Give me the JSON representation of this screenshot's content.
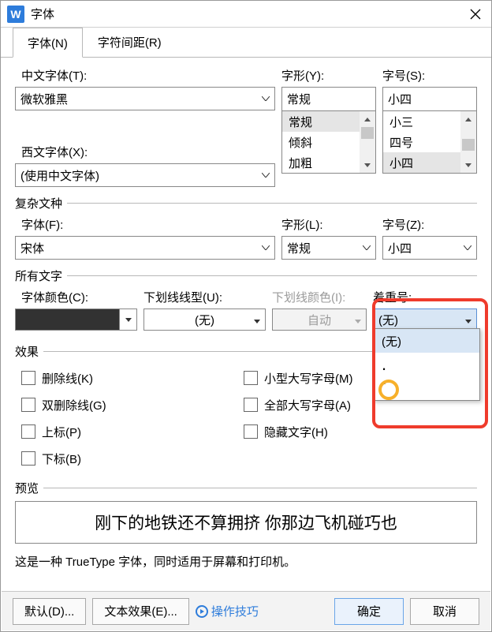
{
  "window": {
    "title": "字体"
  },
  "tabs": {
    "font": "字体(N)",
    "spacing": "字符间距(R)"
  },
  "labels": {
    "cn_font": "中文字体(T):",
    "west_font": "西文字体(X):",
    "style": "字形(Y):",
    "size": "字号(S):",
    "complex_legend": "复杂文种",
    "c_font": "字体(F):",
    "c_style": "字形(L):",
    "c_size": "字号(Z):",
    "all_text_legend": "所有文字",
    "font_color": "字体颜色(C):",
    "underline": "下划线线型(U):",
    "underline_none": "(无)",
    "underline_color": "下划线颜色(I):",
    "underline_color_auto": "自动",
    "emphasis": "着重号:",
    "emphasis_value": "(无)",
    "effects_legend": "效果",
    "preview_legend": "预览"
  },
  "fonts": {
    "cn_value": "微软雅黑",
    "west_value": "(使用中文字体)",
    "c_value": "宋体"
  },
  "styles": {
    "value": "常规",
    "options": [
      "常规",
      "倾斜",
      "加粗"
    ],
    "c_value": "常规"
  },
  "sizes": {
    "value": "小四",
    "options": [
      "小三",
      "四号",
      "小四"
    ],
    "c_value": "小四"
  },
  "emphasis_options": {
    "o0": "(无)",
    "o1": ".",
    "o2": "`"
  },
  "effects": {
    "strike": "删除线(K)",
    "dstrike": "双删除线(G)",
    "super": "上标(P)",
    "sub": "下标(B)",
    "smallcaps": "小型大写字母(M)",
    "allcaps": "全部大写字母(A)",
    "hidden": "隐藏文字(H)"
  },
  "preview_text": "刚下的地铁还不算拥挤   你那边飞机碰巧也",
  "note_text": "这是一种 TrueType 字体，同时适用于屏幕和打印机。",
  "footer": {
    "default": "默认(D)...",
    "text_effects": "文本效果(E)...",
    "tips": "操作技巧",
    "ok": "确定",
    "cancel": "取消"
  }
}
